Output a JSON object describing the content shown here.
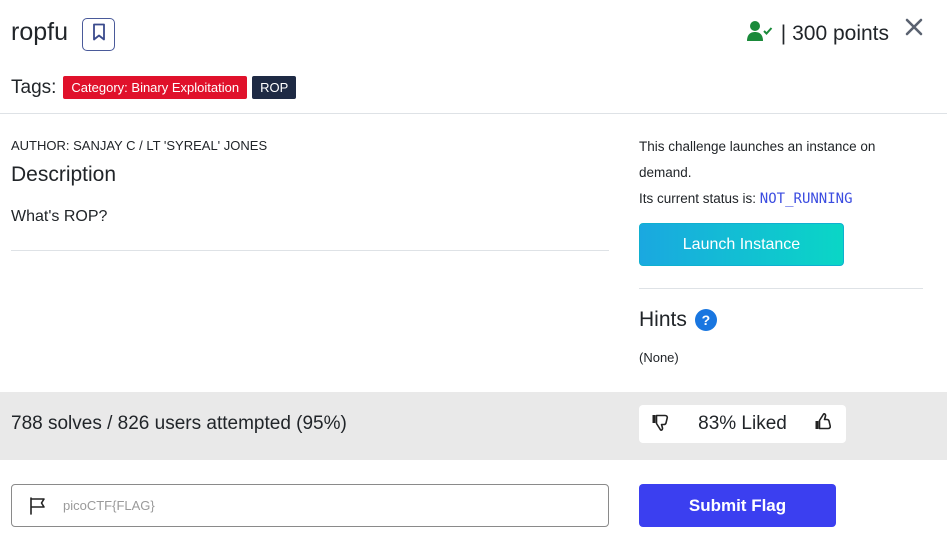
{
  "challenge": {
    "title": "ropfu",
    "points_text": "| 300 points",
    "tags_label": "Tags:",
    "tags": [
      {
        "label": "Category: Binary Exploitation",
        "color": "#e0112b"
      },
      {
        "label": "ROP",
        "color": "#1e2a44"
      }
    ]
  },
  "description": {
    "author": "AUTHOR: SANJAY C / LT 'SYREAL' JONES",
    "heading": "Description",
    "body": "What's ROP?"
  },
  "instance": {
    "launch_text": "This challenge launches an instance on demand.",
    "status_prefix": "Its current status is: ",
    "status_value": "NOT_RUNNING",
    "launch_button": "Launch Instance"
  },
  "hints": {
    "heading": "Hints",
    "help_glyph": "?",
    "content": "(None)"
  },
  "stats": {
    "solves_text": "788 solves / 826 users attempted (95%)",
    "liked_text": "83% Liked"
  },
  "flag": {
    "placeholder": "picoCTF{FLAG}",
    "value": "",
    "submit_label": "Submit Flag"
  },
  "colors": {
    "accent": "#3b3ff0",
    "solved_icon": "#1a8a3a",
    "status_value": "#3b4ce0"
  },
  "icons": [
    "bookmark-icon",
    "user-check-icon",
    "close-icon",
    "help-icon",
    "thumbs-down-icon",
    "thumbs-up-icon",
    "flag-icon"
  ]
}
